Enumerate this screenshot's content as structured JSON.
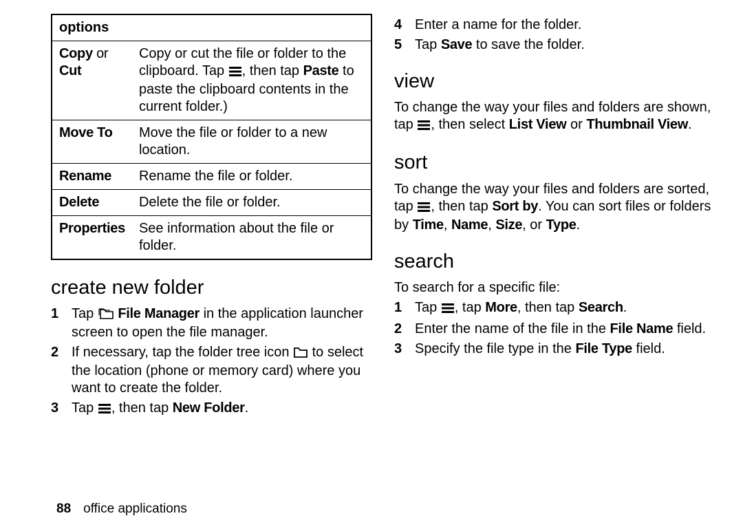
{
  "page_number": "88",
  "footer_label": "office applications",
  "left": {
    "options_table": {
      "header": "options",
      "rows": [
        {
          "name_a": "Copy",
          "name_or": " or ",
          "name_b": "Cut",
          "desc_a": "Copy or cut the file or folder to the clipboard. Tap ",
          "desc_b": ", then tap ",
          "desc_paste": "Paste",
          "desc_c": " to paste the clipboard contents in the current folder.)"
        },
        {
          "name_a": "Move To",
          "desc_a": "Move the file or folder to a new location."
        },
        {
          "name_a": "Rename",
          "desc_a": "Rename the file or folder."
        },
        {
          "name_a": "Delete",
          "desc_a": "Delete the file or folder."
        },
        {
          "name_a": "Properties",
          "desc_a": "See information about the file or folder."
        }
      ]
    },
    "create_heading": "create new folder",
    "create_steps": {
      "s1a": "Tap ",
      "s1_fm": "File Manager",
      "s1b": " in the application launcher screen to open the file manager.",
      "s2a": "If necessary, tap the folder tree icon ",
      "s2b": " to select the location (phone or memory card) where you want to create the folder.",
      "s3a": "Tap ",
      "s3b": ", then tap ",
      "s3_new": "New Folder",
      "s3c": "."
    }
  },
  "right": {
    "cont_steps": {
      "s4": "Enter a name for the folder.",
      "s5a": "Tap ",
      "s5_save": "Save",
      "s5b": " to save the folder."
    },
    "view_heading": "view",
    "view_para": {
      "a": "To change the way your files and folders are shown, tap ",
      "b": ", then select ",
      "lv": "List View",
      "c": " or ",
      "tv": "Thumbnail View",
      "d": "."
    },
    "sort_heading": "sort",
    "sort_para": {
      "a": "To change the way your files and folders are sorted, tap ",
      "b": ", then tap ",
      "sortby": "Sort by",
      "c": ". You can sort files or folders by ",
      "time": "Time",
      "comma1": ", ",
      "name": "Name",
      "comma2": ", ",
      "size": "Size",
      "comma3": ", or ",
      "type": "Type",
      "d": "."
    },
    "search_heading": "search",
    "search_intro": "To search for a specific file:",
    "search_steps": {
      "s1a": "Tap ",
      "s1b": ", tap ",
      "more": "More",
      "s1c": ", then tap ",
      "search": "Search",
      "s1d": ".",
      "s2a": "Enter the name of the file in the ",
      "filename": "File Name",
      "s2b": " field.",
      "s3a": "Specify the file type in the ",
      "filetype": "File Type",
      "s3b": " field."
    }
  }
}
